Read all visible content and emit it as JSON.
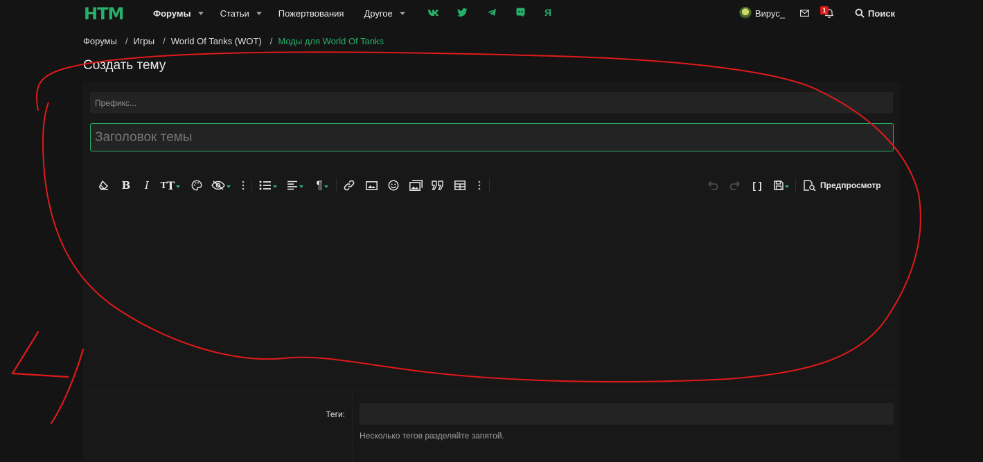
{
  "header": {
    "logo": "HTM",
    "nav": [
      {
        "label": "Форумы",
        "has_dropdown": true
      },
      {
        "label": "Статьи",
        "has_dropdown": true
      },
      {
        "label": "Пожертвования",
        "has_dropdown": false
      },
      {
        "label": "Другое",
        "has_dropdown": true
      }
    ],
    "social_icons": [
      "vk-icon",
      "twitter-icon",
      "telegram-icon",
      "discord-icon",
      "yandex-icon"
    ],
    "yandex_glyph": "Я",
    "username": "Вирус_",
    "alerts_badge": "1",
    "search_label": "Поиск"
  },
  "breadcrumb": [
    "Форумы",
    "Игры",
    "World Of Tanks (WOT)",
    "Моды для World Of Tanks"
  ],
  "page_title": "Создать тему",
  "form": {
    "prefix_placeholder": "Префикс...",
    "title_placeholder": "Заголовок темы",
    "preview_label": "Предпросмотр",
    "tags_label": "Теги:",
    "tags_hint": "Несколько тегов разделяйте запятой."
  },
  "toolbar_icons": [
    "clear-formatting-icon",
    "bold-icon",
    "italic-icon",
    "text-size-icon",
    "color-palette-icon",
    "hide-icon",
    "more-options-icon",
    "list-icon",
    "align-icon",
    "paragraph-icon",
    "link-icon",
    "image-icon",
    "smiley-icon",
    "media-icon",
    "quote-icon",
    "table-icon",
    "more-options-icon",
    "undo-icon",
    "redo-icon",
    "bbcode-icon",
    "drafts-icon",
    "preview-icon"
  ],
  "colors": {
    "accent": "#27b06a",
    "background": "#141414",
    "panel": "#181818",
    "input": "#232323",
    "annotation": "#e01a1a",
    "badge": "#d81b1b"
  }
}
